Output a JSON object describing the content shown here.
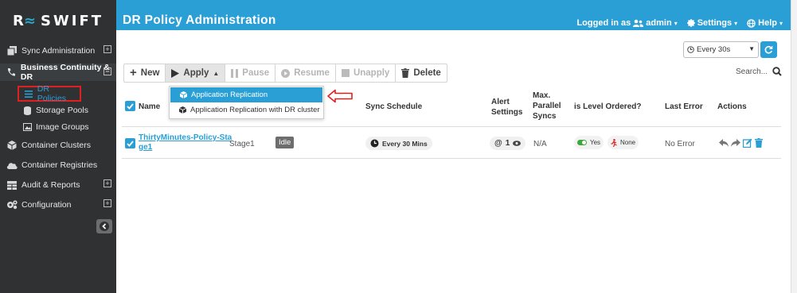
{
  "brand": {
    "logo_mark": "R",
    "name": "SWIFT"
  },
  "header": {
    "title": "DR Policy Administration",
    "logged_in_prefix": "Logged in as",
    "user": "admin",
    "settings": "Settings",
    "help": "Help"
  },
  "sidebar": {
    "items": [
      {
        "label": "Sync Administration"
      },
      {
        "label": "Business Continuity & DR"
      },
      {
        "label": "Container Clusters"
      },
      {
        "label": "Container Registries"
      },
      {
        "label": "Audit & Reports"
      },
      {
        "label": "Configuration"
      }
    ],
    "subitems": [
      {
        "label": "DR Policies"
      },
      {
        "label": "Storage Pools"
      },
      {
        "label": "Image Groups"
      }
    ]
  },
  "refresh": {
    "interval": "Every 30s"
  },
  "toolbar": {
    "new": "New",
    "apply": "Apply",
    "pause": "Pause",
    "resume": "Resume",
    "unapply": "Unapply",
    "delete": "Delete"
  },
  "search": {
    "label": "Search..."
  },
  "apply_menu": {
    "items": [
      "Application Replication",
      "Application Replication with DR cluster"
    ]
  },
  "table": {
    "headers": {
      "name": "Name",
      "sync_schedule": "Sync Schedule",
      "alert_settings_1": "Alert",
      "alert_settings_2": "Settings",
      "max_1": "Max.",
      "max_2": "Parallel",
      "max_3": "Syncs",
      "level_ordered": "is Level Ordered?",
      "last_error": "Last Error",
      "actions": "Actions"
    },
    "rows": [
      {
        "name_line1": "ThirtyMinutes-Policy-Sta",
        "name_line2": "ge1",
        "stage": "Stage1",
        "status": "Idle",
        "schedule": "Every 30 Mins",
        "alert_count": "1",
        "max_parallel": "N/A",
        "level_yes": "Yes",
        "level_none": "None",
        "last_error": "No Error"
      }
    ]
  },
  "colors": {
    "accent": "#2a9fd6",
    "sidebar": "#2f3133",
    "highlight_box": "#e02020"
  }
}
